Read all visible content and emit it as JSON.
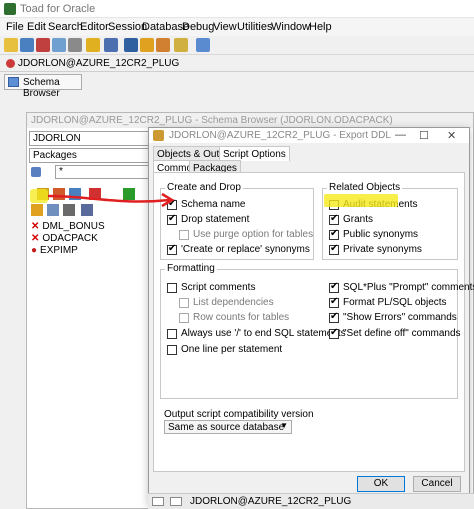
{
  "app": {
    "title": "Toad for Oracle"
  },
  "menu": [
    "File",
    "Edit",
    "Search",
    "Editor",
    "Session",
    "Database",
    "Debug",
    "View",
    "Utilities",
    "Window",
    "Help"
  ],
  "connection_tab": "JDORLON@AZURE_12CR2_PLUG",
  "schema_browser_button": "Schema Browser",
  "schema_browser": {
    "title": "JDORLON@AZURE_12CR2_PLUG - Schema Browser (JDORLON.ODACPACK)",
    "schema": "JDORLON",
    "object_type": "Packages",
    "filter": "*",
    "objects": [
      "DML_BONUS",
      "ODACPACK",
      "EXPIMP"
    ]
  },
  "dialog": {
    "title": "JDORLON@AZURE_12CR2_PLUG - Export DDL",
    "top_tabs": [
      "Objects & Output",
      "Script Options"
    ],
    "sub_tabs": [
      "Common",
      "Packages"
    ],
    "create_drop": {
      "title": "Create and Drop",
      "items": [
        {
          "label": "Schema name",
          "checked": true,
          "enabled": true
        },
        {
          "label": "Drop statement",
          "checked": true,
          "enabled": true
        },
        {
          "label": "Use purge option for tables",
          "checked": false,
          "enabled": false
        },
        {
          "label": "'Create or replace' synonyms",
          "checked": true,
          "enabled": true
        }
      ]
    },
    "related_objects": {
      "title": "Related Objects",
      "items": [
        {
          "label": "Audit statements",
          "checked": false
        },
        {
          "label": "Grants",
          "checked": true
        },
        {
          "label": "Public synonyms",
          "checked": true
        },
        {
          "label": "Private synonyms",
          "checked": true
        }
      ]
    },
    "formatting": {
      "title": "Formatting",
      "left": [
        {
          "label": "Script comments",
          "checked": false,
          "enabled": true
        },
        {
          "label": "List dependencies",
          "checked": false,
          "enabled": false
        },
        {
          "label": "Row counts for tables",
          "checked": false,
          "enabled": false
        },
        {
          "label": "Always use '/' to end SQL statements",
          "checked": false,
          "enabled": true
        },
        {
          "label": "One line per statement",
          "checked": false,
          "enabled": true
        }
      ],
      "right": [
        {
          "label": "SQL*Plus \"Prompt\" comments",
          "checked": true
        },
        {
          "label": "Format PL/SQL objects",
          "checked": true
        },
        {
          "label": "\"Show Errors\" commands",
          "checked": true
        },
        {
          "label": "\"Set define off\" commands",
          "checked": true
        }
      ]
    },
    "compat": {
      "label": "Output script compatibility version",
      "value": "Same as source database"
    },
    "buttons": {
      "ok": "OK",
      "cancel": "Cancel"
    }
  },
  "taskbar": "JDORLON@AZURE_12CR2_PLUG",
  "colors": {
    "highlight": "#f5ea1a",
    "arrow": "#e02020",
    "accent": "#0078d7"
  }
}
